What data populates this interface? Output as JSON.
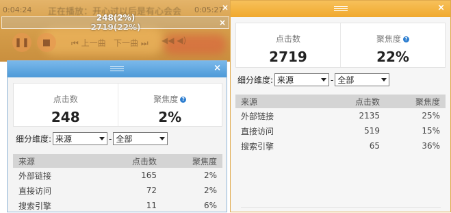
{
  "player": {
    "time_left": "0:04:24",
    "title": "正在播放：开心过以后是有心会会",
    "time_right": "0:05:27",
    "overlay_stat_clicks": "248(2%)",
    "overlay_stat_clicks2": "2719(22%)",
    "prev_label": "上一曲",
    "next_label": "下一曲",
    "pause_icon": "pause-icon",
    "stop_icon": "stop-icon",
    "close_glyph": "×"
  },
  "left_panel": {
    "close_glyph": "×",
    "stats": [
      {
        "label": "点击数",
        "value": "248"
      },
      {
        "label": "聚焦度",
        "value": "2%",
        "help": "?"
      }
    ],
    "filter": {
      "label": "细分维度:",
      "dimension": "来源",
      "separator": "-",
      "scope": "全部"
    },
    "table": {
      "headers": [
        "来源",
        "点击数",
        "聚焦度"
      ],
      "rows": [
        [
          "外部链接",
          "165",
          "2%"
        ],
        [
          "直接访问",
          "72",
          "2%"
        ],
        [
          "搜索引擎",
          "11",
          "6%"
        ]
      ]
    }
  },
  "right_panel": {
    "close_glyph": "×",
    "stats": [
      {
        "label": "点击数",
        "value": "2719"
      },
      {
        "label": "聚焦度",
        "value": "22%",
        "help": "?"
      }
    ],
    "filter": {
      "label": "细分维度:",
      "dimension": "来源",
      "separator": "-",
      "scope": "全部"
    },
    "table": {
      "headers": [
        "来源",
        "点击数",
        "聚焦度"
      ],
      "rows": [
        [
          "外部链接",
          "2135",
          "25%"
        ],
        [
          "直接访问",
          "519",
          "15%"
        ],
        [
          "搜索引擎",
          "65",
          "36%"
        ]
      ]
    }
  },
  "colors": {
    "left_titlebar": "#4d9ad8",
    "right_titlebar": "#f0a92e",
    "header_row": "#d4d4d4",
    "help_icon": "#2d7ed0"
  }
}
